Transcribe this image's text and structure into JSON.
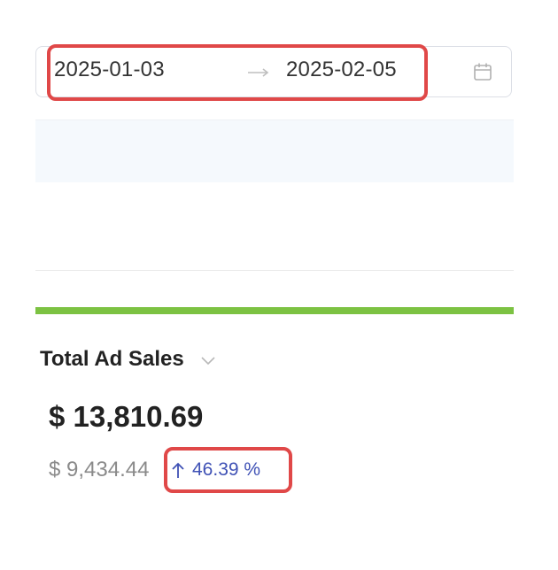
{
  "date_range": {
    "start": "2025-01-03",
    "end": "2025-02-05",
    "separator_icon": "arrow-right-icon",
    "calendar_icon": "calendar-icon"
  },
  "metric": {
    "title": "Total Ad Sales",
    "value": "$ 13,810.69",
    "previous_value": "$ 9,434.44",
    "change": "46.39 %",
    "change_direction_icon": "arrow-up-icon",
    "dropdown_icon": "chevron-down-icon"
  },
  "colors": {
    "highlight": "#e04848",
    "accent_green": "#7cc242",
    "change_blue": "#3f51b5"
  }
}
